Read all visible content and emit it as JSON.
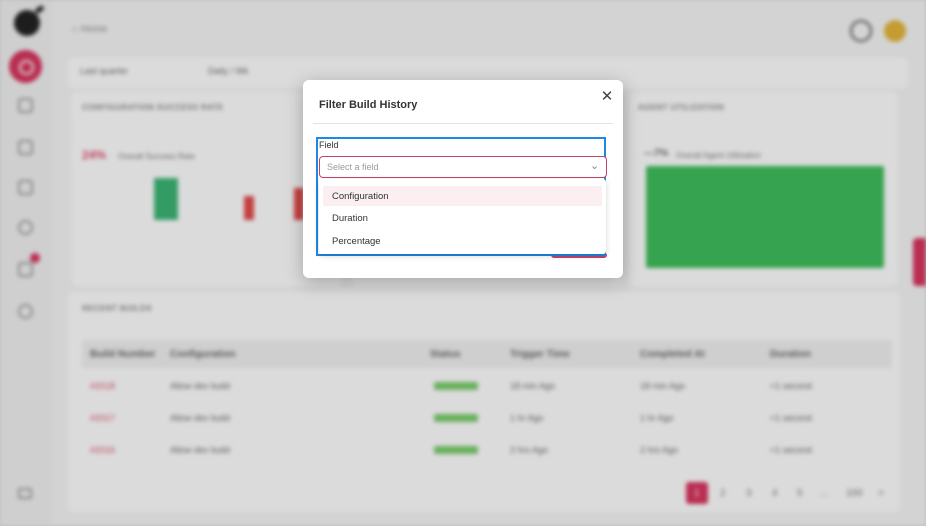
{
  "app": {
    "breadcrumb": "⌂ Home",
    "filters": {
      "chip1": "Last quarter",
      "chip2": "Daily / Wk"
    },
    "cards": {
      "config_title": "CONFIGURATION SUCCESS RATE",
      "agent_title": "AGENT UTILIZATION",
      "recent_title": "RECENT BUILDS",
      "success_value": "24%",
      "success_label": "Overall Success Rate",
      "util_value": "—7%",
      "util_label": "Overall Agent Utilization"
    },
    "table": {
      "columns": [
        "Build Number",
        "Configuration",
        "Status",
        "Trigger Time",
        "Completed At",
        "Duration"
      ],
      "rows": [
        [
          "#2018",
          "Allow dev build",
          "COMPLETED",
          "18 min Ago",
          "18 min Ago",
          "<1 second"
        ],
        [
          "#2017",
          "Allow dev build",
          "COMPLETED",
          "1 hr Ago",
          "1 hr Ago",
          "<1 second"
        ],
        [
          "#2016",
          "Allow dev build",
          "COMPLETED",
          "2 hrs Ago",
          "2 hrs Ago",
          "<1 second"
        ]
      ]
    },
    "pagination": [
      "1",
      "2",
      "3",
      "4",
      "5",
      "...",
      "100",
      ">"
    ]
  },
  "modal": {
    "title": "Filter Build History",
    "close_glyph": "✕",
    "field_label": "Field",
    "select_placeholder": "Select a field",
    "chevron_glyph": "⌄",
    "options": [
      "Configuration",
      "Duration",
      "Percentage"
    ]
  },
  "colors": {
    "accent": "#d3345d",
    "highlight": "#1e88e5",
    "success": "#3dba5a"
  }
}
